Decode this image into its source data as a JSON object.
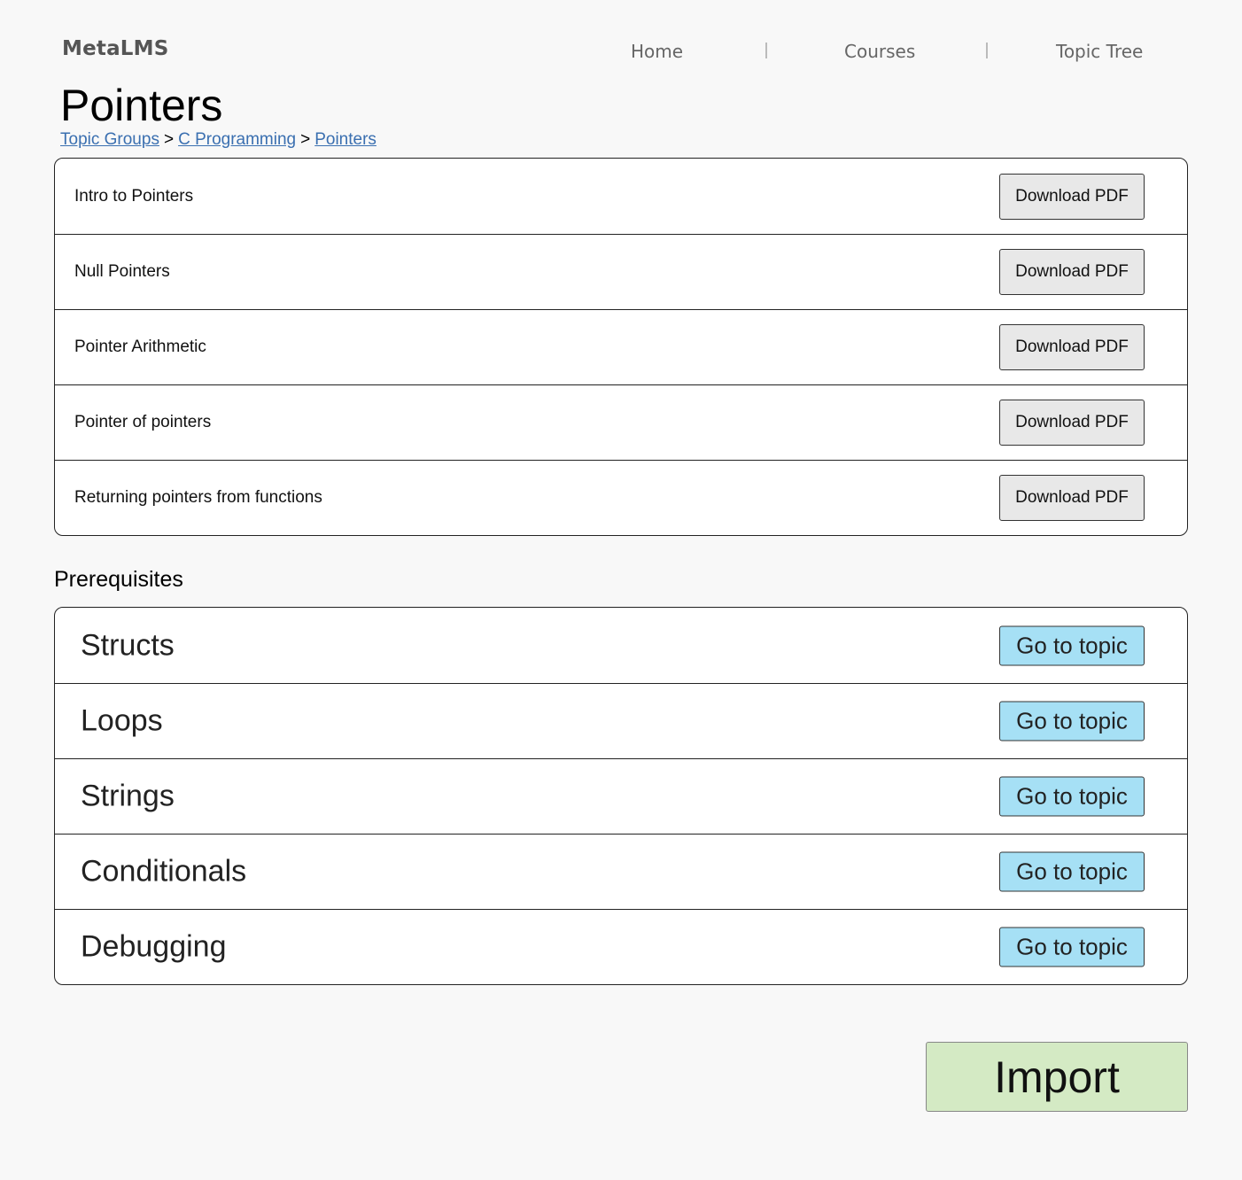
{
  "header": {
    "logo": "MetaLMS",
    "nav": [
      "Home",
      "Courses",
      "Topic Tree"
    ]
  },
  "page": {
    "title": "Pointers",
    "breadcrumb": [
      "Topic Groups",
      "C Programming",
      "Pointers"
    ],
    "breadcrumb_separator": ">"
  },
  "lessons": {
    "items": [
      {
        "title": "Intro to Pointers",
        "button": "Download PDF"
      },
      {
        "title": "Null Pointers",
        "button": "Download PDF"
      },
      {
        "title": "Pointer Arithmetic",
        "button": "Download PDF"
      },
      {
        "title": "Pointer of pointers",
        "button": "Download PDF"
      },
      {
        "title": "Returning pointers from functions",
        "button": "Download PDF"
      }
    ]
  },
  "prerequisites": {
    "heading": "Prerequisites",
    "items": [
      {
        "title": "Structs",
        "button": "Go to topic"
      },
      {
        "title": "Loops",
        "button": "Go to topic"
      },
      {
        "title": "Strings",
        "button": "Go to topic"
      },
      {
        "title": "Conditionals",
        "button": "Go to topic"
      },
      {
        "title": "Debugging",
        "button": "Go to topic"
      }
    ]
  },
  "actions": {
    "import_label": "Import"
  },
  "colors": {
    "background": "#f8f8f8",
    "link": "#3a6fb0",
    "go_to_topic_button": "#a6e0f5",
    "download_button": "#e8e8e8",
    "import_button": "#d4eac4"
  }
}
